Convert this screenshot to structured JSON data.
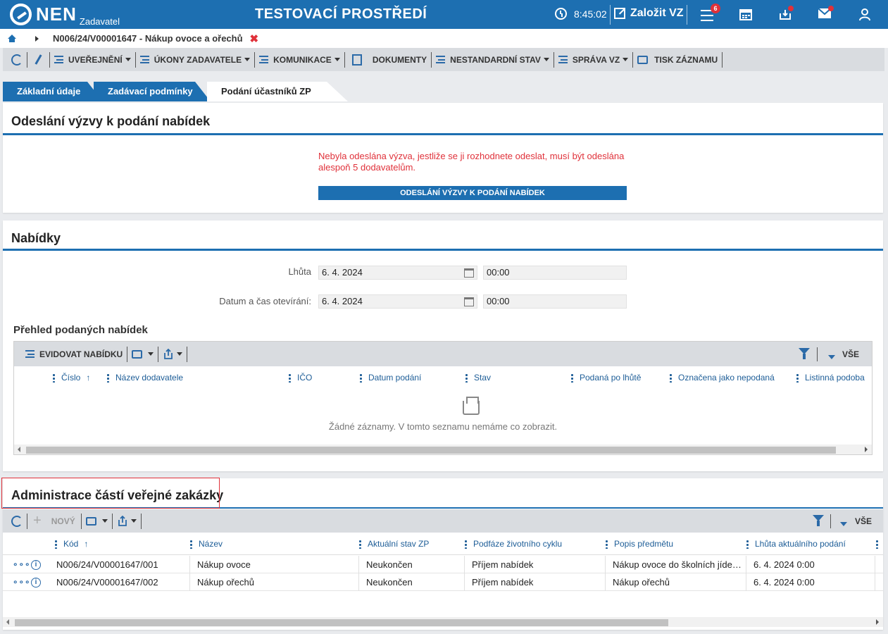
{
  "app": {
    "logo": "NEN",
    "logo_sub": "Zadavatel",
    "environment_title": "TESTOVACÍ PROSTŘEDÍ",
    "clock": "8:45:02",
    "create_label": "Založit VZ",
    "notifications_count": "6"
  },
  "breadcrumb": {
    "current": "N006/24/V00001647 - Nákup ovoce a ořechů",
    "close_symbol": "✖"
  },
  "toolbar": {
    "items": [
      {
        "label": "UVEŘEJNĚNÍ"
      },
      {
        "label": "ÚKONY ZADAVATELE"
      },
      {
        "label": "KOMUNIKACE"
      },
      {
        "label": "DOKUMENTY"
      },
      {
        "label": "NESTANDARDNÍ STAV"
      },
      {
        "label": "SPRÁVA VZ"
      },
      {
        "label": "TISK ZÁZNAMU"
      }
    ]
  },
  "tabs": [
    {
      "label": "Základní údaje"
    },
    {
      "label": "Zadávací podmínky"
    },
    {
      "label": "Podání účastníků ZP"
    }
  ],
  "panel_invite": {
    "title": "Odeslání výzvy k podání nabídek",
    "warning": "Nebyla odeslána výzva, jestliže se ji rozhodnete odeslat, musí být odeslána alespoň 5 dodavatelům.",
    "button": "ODESLÁNÍ VÝZVY K PODÁNÍ NABÍDEK"
  },
  "panel_offers": {
    "title": "Nabídky",
    "deadline_label": "Lhůta",
    "deadline_date": "6. 4. 2024",
    "deadline_time": "00:00",
    "opening_label": "Datum a čas otevírání:",
    "opening_date": "6. 4. 2024",
    "opening_time": "00:00",
    "overview_title": "Přehled podaných nabídek",
    "grid_toolbar": {
      "register_label": "EVIDOVAT NABÍDKU",
      "all_label": "VŠE"
    },
    "columns": [
      "Číslo",
      "Název dodavatele",
      "IČO",
      "Datum podání",
      "Stav",
      "Podaná po lhůtě",
      "Označena jako nepodaná",
      "Listinná podoba"
    ],
    "empty_text": "Žádné záznamy. V tomto seznamu nemáme co zobrazit."
  },
  "panel_parts": {
    "title": "Administrace částí veřejné zakázky",
    "toolbar": {
      "new_label": "NOVÝ",
      "all_label": "VŠE"
    },
    "columns": [
      "Kód",
      "Název",
      "Aktuální stav ZP",
      "Podfáze životního cyklu",
      "Popis předmětu",
      "Lhůta aktuálního podání"
    ],
    "rows": [
      {
        "code": "N006/24/V00001647/001",
        "name": "Nákup ovoce",
        "state": "Neukončen",
        "phase": "Příjem nabídek",
        "description": "Nákup ovoce do školních jídelen",
        "deadline": "6. 4. 2024 0:00"
      },
      {
        "code": "N006/24/V00001647/002",
        "name": "Nákup ořechů",
        "state": "Neukončen",
        "phase": "Příjem nabídek",
        "description": "Nákup ořechů",
        "deadline": "6. 4. 2024 0:00"
      }
    ]
  },
  "colors": {
    "brand_blue": "#1d6fb1",
    "warning_red": "#e0313a",
    "toolbar_gray": "#d9dce0"
  }
}
